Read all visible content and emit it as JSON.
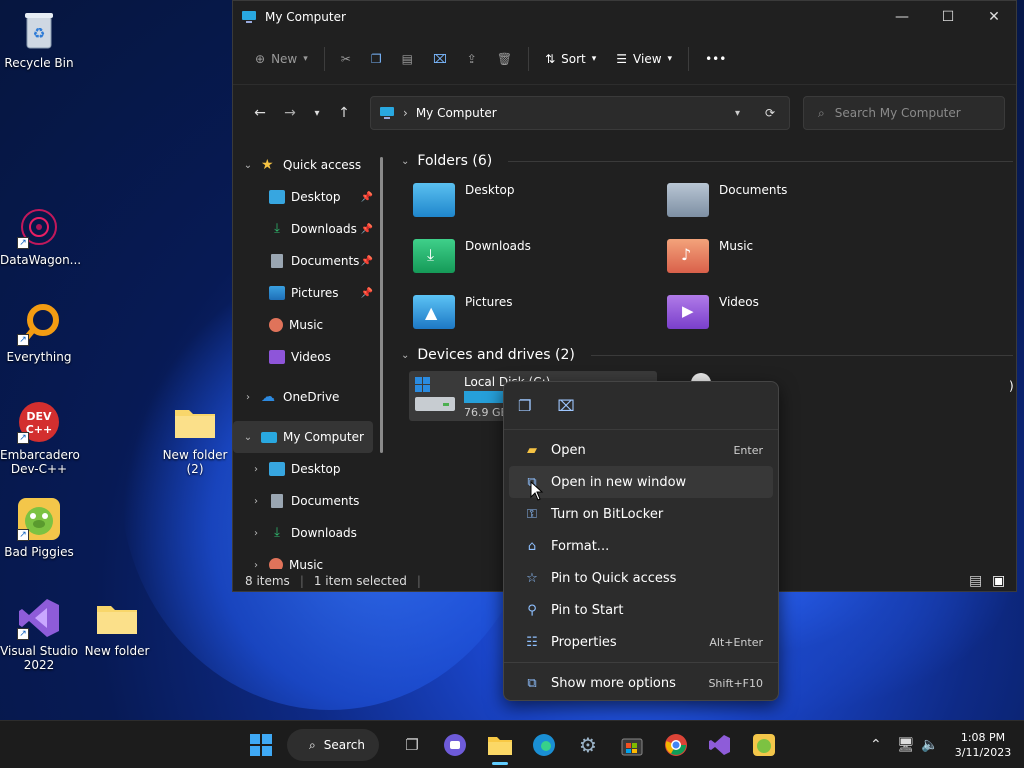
{
  "desktop": {
    "icons": [
      {
        "label": "Recycle Bin"
      },
      {
        "label": "DataWagon..."
      },
      {
        "label": "Everything"
      },
      {
        "label": "Embarcadero\nDev-C++"
      },
      {
        "label": "New folder\n(2)"
      },
      {
        "label": "Bad Piggies"
      },
      {
        "label": "Visual Studio\n2022"
      },
      {
        "label": "New folder"
      }
    ]
  },
  "window": {
    "title": "My Computer",
    "toolbar": {
      "new_label": "New",
      "sort_label": "Sort",
      "view_label": "View",
      "more_label": "•••"
    },
    "address": {
      "path": "My Computer"
    },
    "search": {
      "placeholder": "Search My Computer"
    },
    "nav": {
      "quick_access": "Quick access",
      "quick_items": [
        "Desktop",
        "Downloads",
        "Documents",
        "Pictures",
        "Music",
        "Videos"
      ],
      "onedrive": "OneDrive",
      "my_computer": "My Computer",
      "computer_items": [
        "Desktop",
        "Documents",
        "Downloads",
        "Music"
      ]
    },
    "sections": {
      "folders": "Folders (6)",
      "devices": "Devices and drives (2)"
    },
    "folders": [
      "Desktop",
      "Documents",
      "Downloads",
      "Music",
      "Pictures",
      "Videos"
    ],
    "drive": {
      "name": "Local Disk (C:)",
      "size": "76.9 GB",
      "second_suffix": ")"
    },
    "status": {
      "items": "8 items",
      "selected": "1 item selected"
    }
  },
  "context_menu": {
    "items": [
      {
        "label": "Open",
        "shortcut": "Enter"
      },
      {
        "label": "Open in new window",
        "shortcut": ""
      },
      {
        "label": "Turn on BitLocker",
        "shortcut": ""
      },
      {
        "label": "Format...",
        "shortcut": ""
      },
      {
        "label": "Pin to Quick access",
        "shortcut": ""
      },
      {
        "label": "Pin to Start",
        "shortcut": ""
      },
      {
        "label": "Properties",
        "shortcut": "Alt+Enter"
      },
      {
        "label": "Show more options",
        "shortcut": "Shift+F10"
      }
    ]
  },
  "taskbar": {
    "search_label": "Search",
    "time": "1:08 PM",
    "date": "3/11/2023"
  },
  "colors": {
    "accent": "#3aa0e0",
    "selection": "#353535"
  }
}
